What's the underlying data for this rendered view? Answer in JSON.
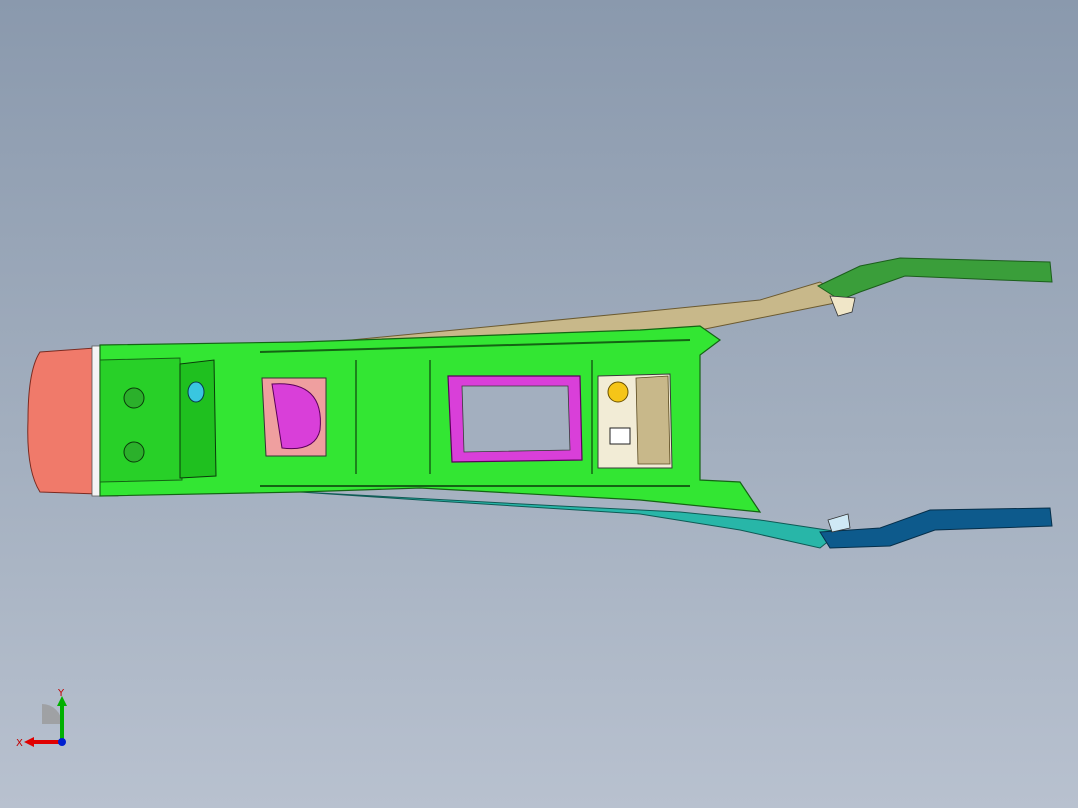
{
  "viewport": {
    "colors": {
      "background_top": "#8a99ad",
      "background_bottom": "#b8c1cf",
      "body_green": "#33e633",
      "body_green_dark": "#1fa81f",
      "front_cap": "#f07a6a",
      "insert_magenta": "#d93fd9",
      "rear_arm_upper": "#3a9e3a",
      "rear_arm_lower": "#0d5a8c",
      "tan_panel": "#c8b88a",
      "cream_pocket": "#f2ecd6",
      "yellow_dot": "#f5c518",
      "cyan_accent": "#39c6e0"
    }
  },
  "triad": {
    "icon": "coordinate-triad-icon",
    "x_label": "X",
    "y_label": "Y",
    "x_color": "#e00000",
    "y_color": "#00b000",
    "z_color": "#0020d0"
  }
}
